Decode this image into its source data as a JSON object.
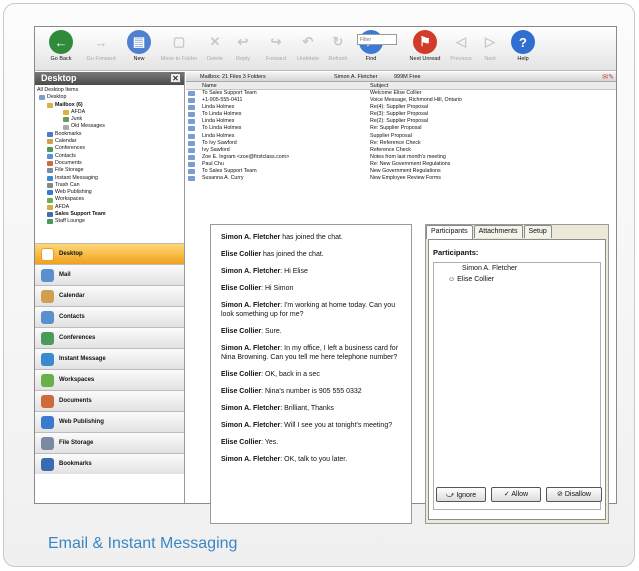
{
  "toolbar": {
    "buttons": [
      {
        "label": "Go Back",
        "icon": "back-arrow-icon",
        "color": "#2e8b3a",
        "enabled": true
      },
      {
        "label": "Go Forward",
        "icon": "forward-arrow-icon",
        "color": "#b9b9b9",
        "enabled": false
      },
      {
        "label": "New",
        "icon": "new-document-icon",
        "color": "#4f7fcf",
        "enabled": true
      },
      {
        "label": "Move to Folder",
        "icon": "move-folder-icon",
        "color": "#c8c8c8",
        "enabled": false
      },
      {
        "label": "Delete",
        "icon": "delete-x-icon",
        "color": "#c8c8c8",
        "enabled": false
      },
      {
        "label": "Reply",
        "icon": "reply-icon",
        "color": "#c8c8c8",
        "enabled": false
      },
      {
        "label": "Forward",
        "icon": "forward-icon",
        "color": "#c8c8c8",
        "enabled": false
      },
      {
        "label": "Undelete",
        "icon": "undelete-icon",
        "color": "#c8c8c8",
        "enabled": false
      },
      {
        "label": "Refresh",
        "icon": "refresh-icon",
        "color": "#c8c8c8",
        "enabled": false
      },
      {
        "label": "Find",
        "icon": "magnifier-icon",
        "color": "#3d7ad6",
        "enabled": true
      },
      {
        "label": "Next Unread",
        "icon": "next-unread-flag-icon",
        "color": "#d23a2a",
        "enabled": true
      },
      {
        "label": "Previous",
        "icon": "previous-icon",
        "color": "#c8c8c8",
        "enabled": false
      },
      {
        "label": "Next",
        "icon": "next-icon",
        "color": "#c8c8c8",
        "enabled": false
      },
      {
        "label": "Help",
        "icon": "help-question-icon",
        "color": "#2f6fcf",
        "enabled": true
      }
    ],
    "filter_placeholder": "Filter"
  },
  "left_panel": {
    "title": "Desktop",
    "close": "✕",
    "tree": [
      "All Desktop Items",
      "Desktop",
      "Mailbox (6)",
      "AFDA",
      "Junk",
      "Old Messages",
      "Bookmarks",
      "Calendar",
      "Conferences",
      "Contacts",
      "Documents",
      "File Storage",
      "Instant Messaging",
      "Trash Can",
      "Web Publishing",
      "Workspaces",
      "AFDA",
      "Sales Support Team",
      "Staff Lounge"
    ],
    "nav": [
      {
        "label": "Desktop",
        "icon": "desktop-icon",
        "color": "#f0a11a"
      },
      {
        "label": "Mail",
        "icon": "mail-icon",
        "color": "#5a8fd0"
      },
      {
        "label": "Calendar",
        "icon": "calendar-icon",
        "color": "#d0a050"
      },
      {
        "label": "Contacts",
        "icon": "contacts-icon",
        "color": "#5a8fd0"
      },
      {
        "label": "Conferences",
        "icon": "conferences-icon",
        "color": "#4a9a5a"
      },
      {
        "label": "Instant Message",
        "icon": "instant-message-icon",
        "color": "#3a8ad0"
      },
      {
        "label": "Workspaces",
        "icon": "workspaces-icon",
        "color": "#6ab04a"
      },
      {
        "label": "Documents",
        "icon": "documents-icon",
        "color": "#d06a3a"
      },
      {
        "label": "Web Publishing",
        "icon": "web-publishing-icon",
        "color": "#3a7ad0"
      },
      {
        "label": "File Storage",
        "icon": "file-storage-icon",
        "color": "#7a8aa0"
      },
      {
        "label": "Bookmarks",
        "icon": "bookmarks-icon",
        "color": "#3a6ab0"
      }
    ]
  },
  "mailbox": {
    "header": "Mailbox:  21 Files  3 Folders",
    "user": "Simon A. Fletcher",
    "free": "999M Free",
    "col_name": "Name",
    "col_subject": "Subject",
    "rows": [
      {
        "from": "To  Sales Support Team",
        "subject": "Welcome Elise Collier"
      },
      {
        "from": "+1-905-555-0411",
        "subject": "Voice Message, Richmond Hill, Ontario"
      },
      {
        "from": "Linda Holmes",
        "subject": "Re(4): Supplier Proposal"
      },
      {
        "from": "To  Linda Holmes",
        "subject": "Re(3): Supplier Proposal"
      },
      {
        "from": "Linda Holmes",
        "subject": "Re(2): Supplier Proposal"
      },
      {
        "from": "To  Linda Holmes",
        "subject": "Re: Supplier Proposal"
      },
      {
        "from": "Linda Holmes",
        "subject": "Supplier Proposal"
      },
      {
        "from": "To  Ivy Sawford",
        "subject": "Re: Reference Check"
      },
      {
        "from": "Ivy Sawford",
        "subject": "Reference Check"
      },
      {
        "from": "Zoe E. Ingram <zoe@firstclass.com>",
        "subject": "Notes from last month's meeting"
      },
      {
        "from": "Paul Chu",
        "subject": "Re: New Government Regulations"
      },
      {
        "from": "To  Sales Support Team",
        "subject": "New Government Regulations"
      },
      {
        "from": "Susanna A. Curry",
        "subject": "New Employee Review Forms"
      }
    ]
  },
  "chat": {
    "messages": [
      {
        "sender": "Simon A. Fletcher",
        "text": " has joined the chat."
      },
      {
        "sender": "Elise Collier",
        "text": " has joined the chat."
      },
      {
        "sender": "Simon A. Fletcher",
        "text": ": Hi Elise"
      },
      {
        "sender": "Elise Collier",
        "text": ": Hi Simon"
      },
      {
        "sender": "Simon A. Fletcher",
        "text": ": I'm working at home today. Can you look something up for me?"
      },
      {
        "sender": "Elise Collier",
        "text": ": Sure."
      },
      {
        "sender": "Simon A. Fletcher",
        "text": ": In my office, I left a business card for Nina Browning. Can you tell me here telephone number?"
      },
      {
        "sender": "Elise Collier",
        "text": ": OK, back in a sec"
      },
      {
        "sender": "Elise Collier",
        "text": ": Nina's number is 905 555 0332"
      },
      {
        "sender": "Simon A. Fletcher",
        "text": ": Brilliant, Thanks"
      },
      {
        "sender": "Simon A. Fletcher",
        "text": ": Will I see you at tonight's meeting?"
      },
      {
        "sender": "Elise Collier",
        "text": ": Yes."
      },
      {
        "sender": "Simon A. Fletcher",
        "text": ": OK, talk to you later."
      }
    ]
  },
  "participants_window": {
    "tabs": [
      "Participants",
      "Attachments",
      "Setup"
    ],
    "title": "Participants:",
    "people": [
      "Simon A. Fletcher",
      "Elise Collier"
    ],
    "buttons": {
      "ignore": "Ignore",
      "allow": "Allow",
      "disallow": "Disallow"
    }
  },
  "caption": "Email & Instant Messaging"
}
